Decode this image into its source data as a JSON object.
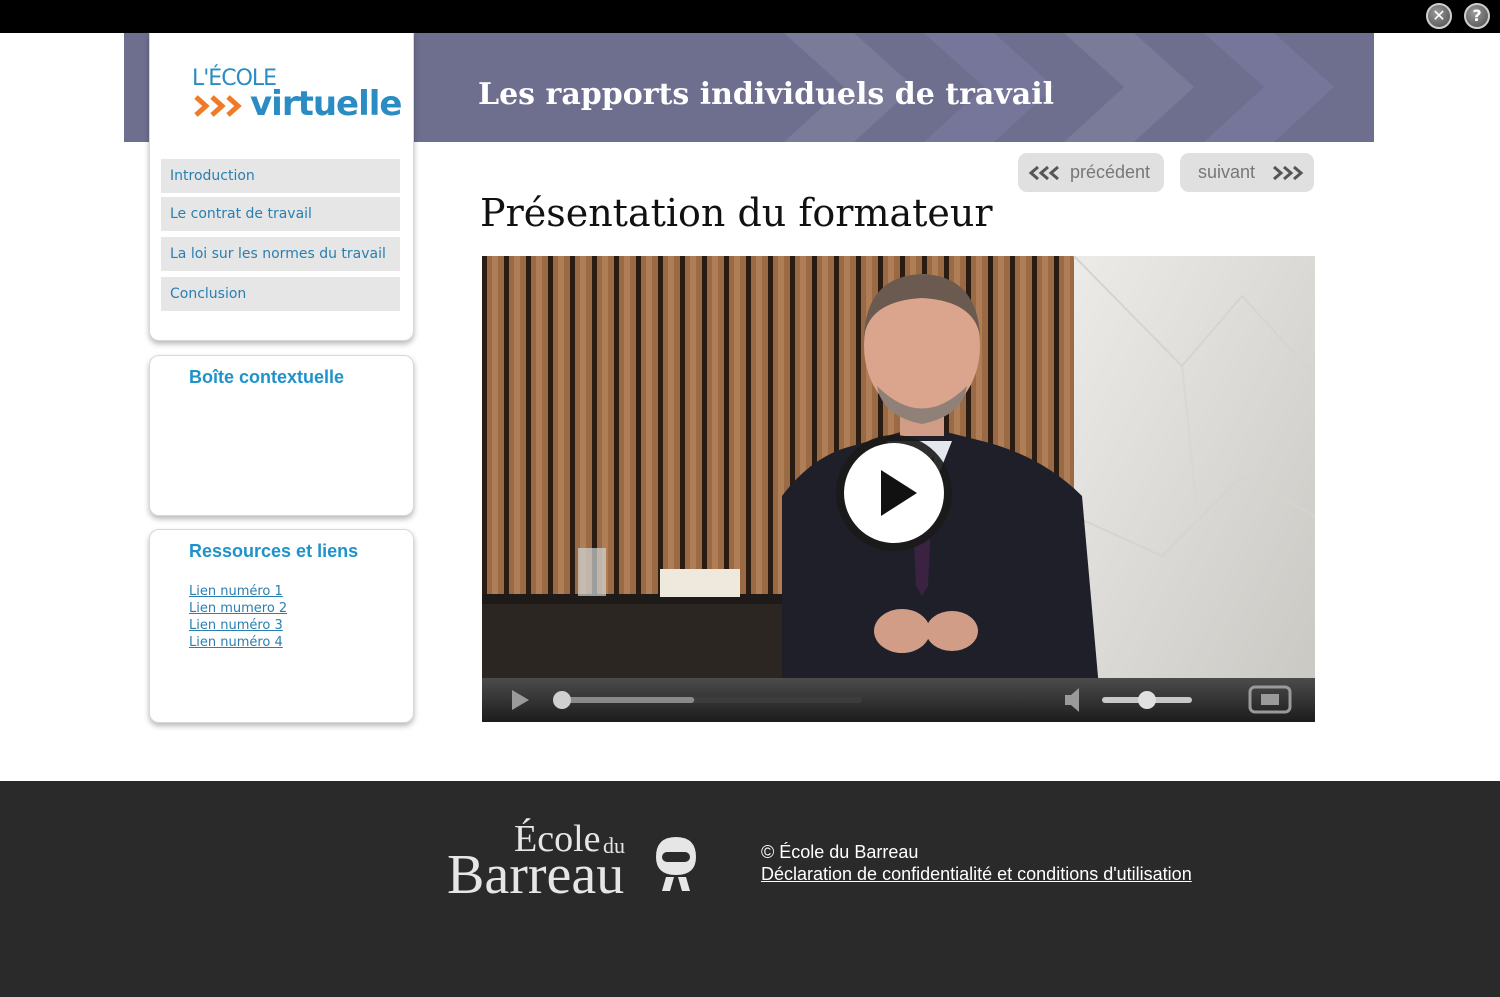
{
  "window": {
    "close_icon": "close-icon",
    "help_icon": "help-icon",
    "help_glyph": "?",
    "close_glyph": "✕"
  },
  "header": {
    "logo_top": "L'ÉCOLE",
    "logo_bottom": "virtuelle",
    "title": "Les rapports individuels de travail"
  },
  "sidebar": {
    "items": [
      {
        "label": "Introduction"
      },
      {
        "label": "Le contrat de travail"
      },
      {
        "label": "La loi sur les normes du travail"
      },
      {
        "label": "Conclusion"
      }
    ]
  },
  "context_box": {
    "title": "Boîte contextuelle"
  },
  "resources": {
    "title": "Ressources et liens",
    "links": [
      {
        "label": "Lien numéro 1"
      },
      {
        "label": "Lien mumero 2"
      },
      {
        "label": "Lien numéro 3"
      },
      {
        "label": "Lien numéro 4"
      }
    ]
  },
  "navigation": {
    "prev_label": "précédent",
    "next_label": "suivant"
  },
  "main": {
    "title": "Présentation du formateur"
  },
  "video": {
    "progress": 0.0,
    "volume": 0.5,
    "buffered": 0.45
  },
  "footer": {
    "logo_ecole": "École",
    "logo_du": "du",
    "logo_barreau": "Barreau",
    "copyright": "© École du Barreau",
    "privacy_link": "Déclaration de confidentialité et conditions d'utilisation"
  },
  "colors": {
    "accent": "#2b8cc4",
    "banner": "#6e6f8e",
    "logo_arrows": "#f07a2a",
    "footer": "#2a2a2a"
  }
}
